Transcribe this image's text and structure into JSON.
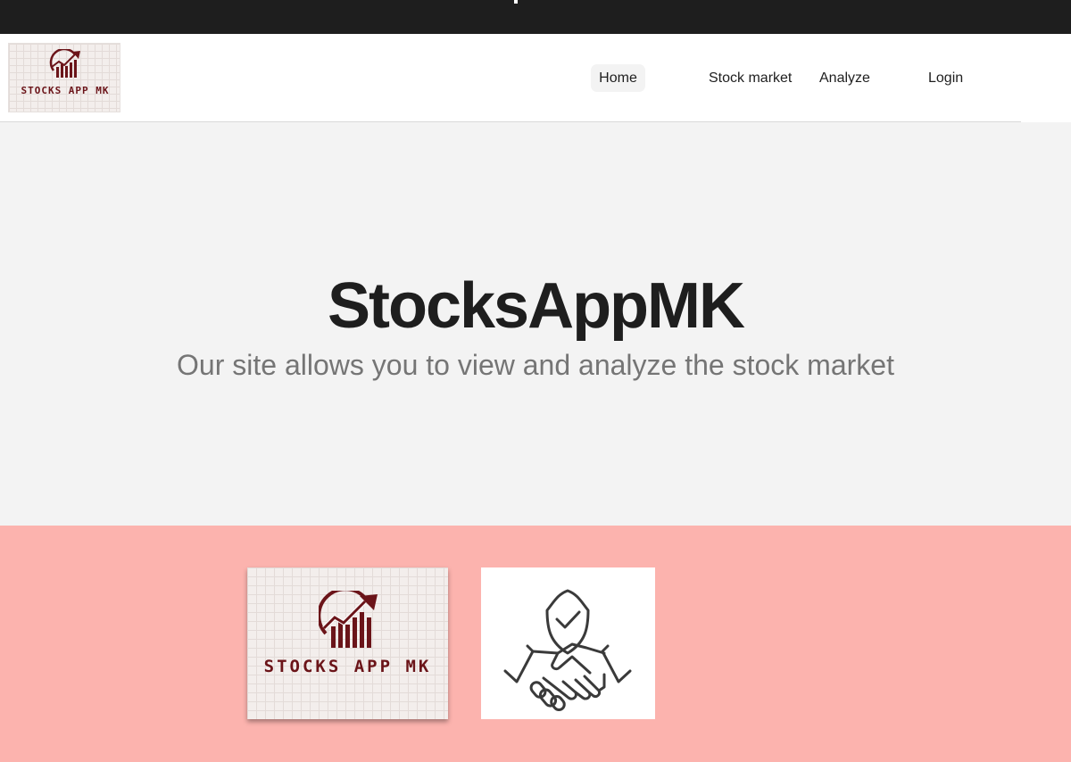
{
  "brand": {
    "logo_text": "STOCKS APP MK",
    "logo_color": "#6b1419"
  },
  "nav": {
    "items": [
      {
        "label": "Home",
        "active": true
      },
      {
        "label": "Stock market",
        "active": false
      },
      {
        "label": "Analyze",
        "active": false
      },
      {
        "label": "Login",
        "active": false
      }
    ]
  },
  "hero": {
    "title": "StocksAppMK",
    "subtitle": "Our site allows you to view and analyze the stock market"
  },
  "features": {
    "cards": [
      {
        "icon": "stocks-app-logo",
        "text": "STOCKS APP MK"
      },
      {
        "icon": "handshake-shield-icon"
      }
    ]
  },
  "colors": {
    "topbar": "#1e1e1e",
    "hero_bg": "#f3f3f3",
    "feature_bg": "#fcb3ae",
    "text_dark": "#1e1e1e",
    "text_muted": "#757575"
  }
}
